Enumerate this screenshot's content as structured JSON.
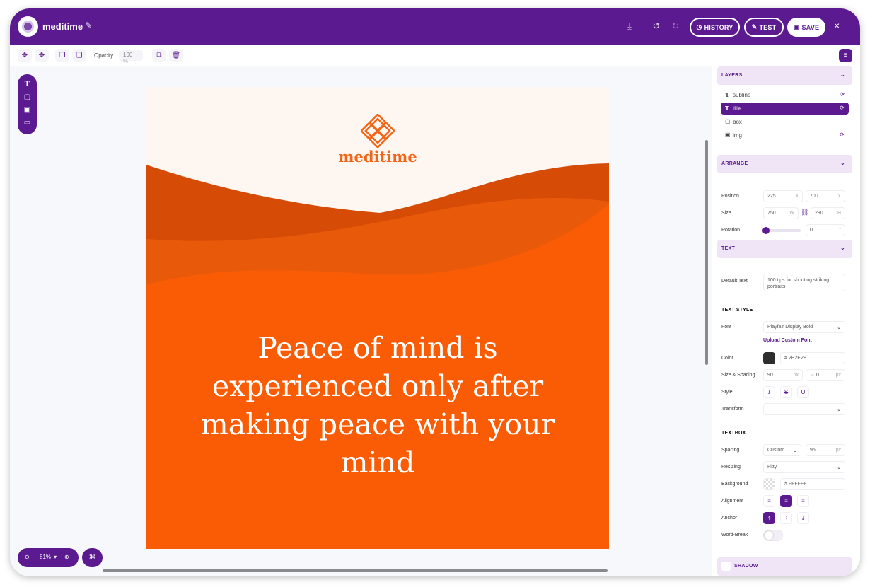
{
  "header": {
    "app_name": "meditime",
    "history_label": "HISTORY",
    "test_label": "TEST",
    "save_label": "SAVE",
    "close_label": "×"
  },
  "toolbar": {
    "opacity_label": "Opacity",
    "opacity_value": "100",
    "opacity_unit": "%"
  },
  "canvas": {
    "brand_name": "meditime",
    "quote": "Peace of mind is experienced only after making peace with your mind",
    "colors": {
      "background": "#fdf6f1",
      "wave_dark": "#d64c06",
      "wave_mid": "#e85a0a",
      "wave_main": "#fa5c05",
      "brand": "#f2661a",
      "quote_text": "#ffffff"
    }
  },
  "zoom": {
    "value": "81%"
  },
  "panel": {
    "layers": {
      "title": "LAYERS",
      "items": [
        {
          "label": "subline",
          "icon": "text-icon"
        },
        {
          "label": "title",
          "icon": "text-icon"
        },
        {
          "label": "box",
          "icon": "box-icon"
        },
        {
          "label": "img",
          "icon": "image-icon"
        }
      ]
    },
    "arrange": {
      "title": "ARRANGE",
      "position_label": "Position",
      "x_value": "225",
      "x_unit": "X",
      "y_value": "700",
      "y_unit": "Y",
      "size_label": "Size",
      "w_value": "750",
      "w_unit": "W",
      "h_value": "290",
      "h_unit": "H",
      "rotation_label": "Rotation",
      "rotation_value": "0",
      "rotation_unit": "°",
      "rotation_slider_fraction": 0
    },
    "text": {
      "title": "TEXT",
      "default_text_label": "Default Text",
      "default_text_value": "100 tips for shooting striking portraits",
      "text_style_title": "TEXT STYLE",
      "font_label": "Font",
      "font_value": "Playfair Display Bold",
      "upload_font_label": "Upload Custom Font",
      "color_label": "Color",
      "color_value": "# 2E2E2E",
      "color_swatch": "#2e2e2e",
      "size_spacing_label": "Size & Spacing",
      "size_value": "90",
      "size_unit": "px",
      "spacing_value": "0",
      "spacing_unit": "px",
      "style_label": "Style",
      "transform_label": "Transform",
      "transform_value": ""
    },
    "textbox": {
      "title": "TEXTBOX",
      "spacing_label": "Spacing",
      "spacing_mode": "Custom",
      "spacing_value": "96",
      "spacing_unit": "px",
      "resizing_label": "Resizing",
      "resizing_value": "Fitty",
      "background_label": "Background",
      "background_value": "# FFFFFF",
      "alignment_label": "Alignment",
      "anchor_label": "Anchor",
      "word_break_label": "Word-Break"
    },
    "shadow": {
      "title": "SHADOW"
    }
  },
  "colors": {
    "brand_purple": "#5b1a8f",
    "section_bg": "#efe5f6"
  }
}
